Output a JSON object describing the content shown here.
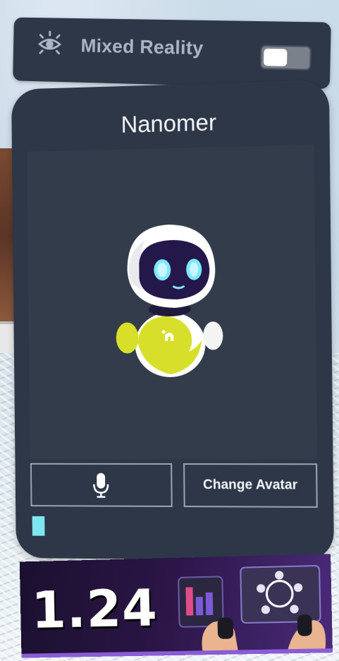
{
  "mixed_reality": {
    "label": "Mixed Reality",
    "icon": "eye-icon",
    "toggle_on": false
  },
  "avatar_panel": {
    "title": "Nanomer",
    "avatar": "robot-avatar",
    "mic_button_icon": "microphone-icon",
    "change_avatar_label": "Change Avatar",
    "voice_level_color": "#7fe6f0"
  },
  "banner": {
    "version": "1.24"
  },
  "colors": {
    "panel": "#2d3748",
    "viewport": "#323c4b",
    "robot_accent": "#d7df2a",
    "robot_eyes": "#7ee9ff"
  }
}
